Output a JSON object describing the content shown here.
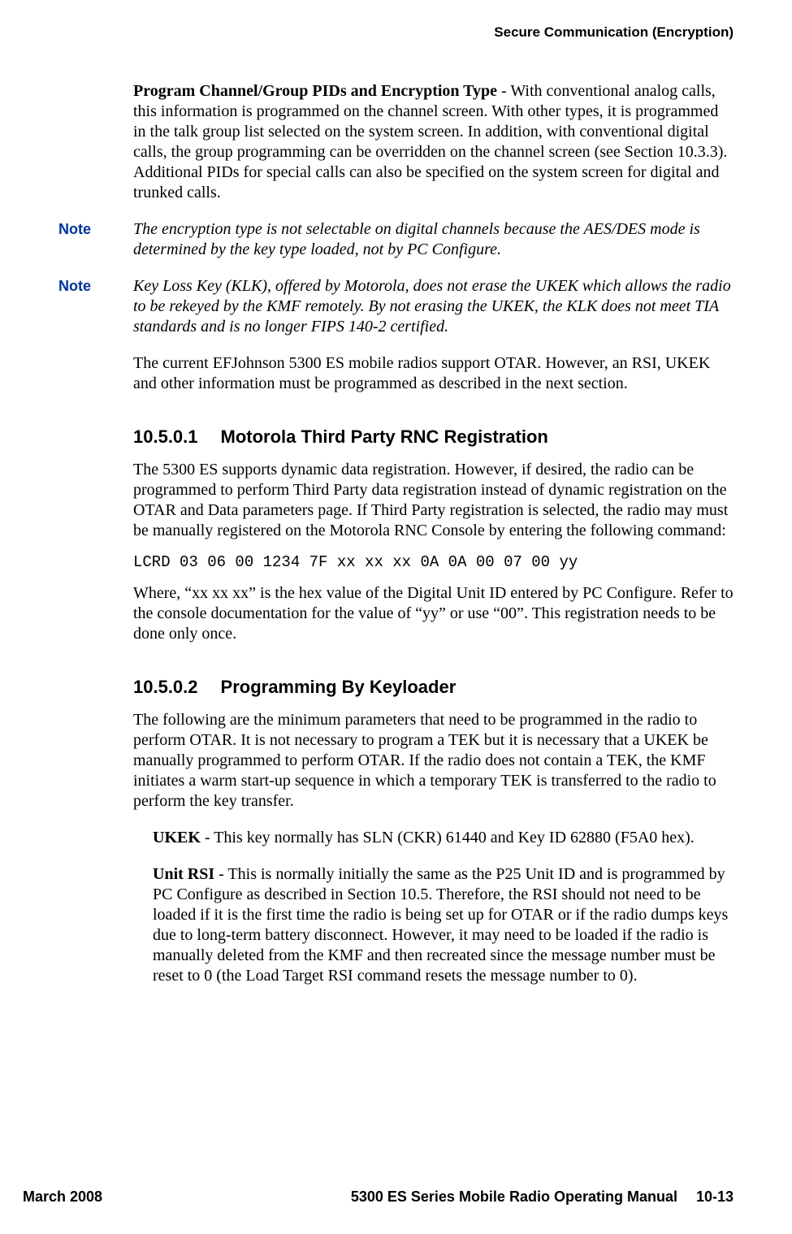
{
  "header": {
    "section_title": "Secure Communication (Encryption)"
  },
  "body": {
    "para1_bold": "Program Channel/Group PIDs and Encryption Type",
    "para1_rest": " - With conventional analog calls, this information is programmed on the channel screen. With other types, it is programmed in the talk group list selected on the system screen. In addition, with conventional digital calls, the group programming can be overridden on the channel screen (see Section 10.3.3). Additional PIDs for special calls can also be specified on the system screen for digital and trunked calls.",
    "note1_label": "Note",
    "note1_text": "The encryption type is not selectable on digital channels because the AES/DES mode is determined by the key type loaded, not by PC Configure.",
    "note2_label": "Note",
    "note2_text": "Key Loss Key (KLK), offered by Motorola, does not erase the UKEK which allows the radio to be rekeyed by the KMF remotely. By not erasing the UKEK, the KLK does not meet TIA standards and is no longer FIPS 140-2 certified.",
    "para2": "The current EFJohnson 5300 ES mobile radios support OTAR. However, an RSI, UKEK and other information must be programmed as described in the next section.",
    "h1_num": "10.5.0.1",
    "h1_title": "Motorola Third Party RNC Registration",
    "para3": "The 5300 ES supports dynamic data registration. However, if desired, the radio can be programmed to perform Third Party data registration instead of dynamic registration on the OTAR and Data parameters page. If Third Party registration is selected, the radio may must be manually registered on the Motorola RNC Console by entering the following command:",
    "code1": "LCRD 03 06 00 1234 7F xx xx xx 0A 0A 00 07 00 yy",
    "para4": "Where, “xx xx xx” is the hex value of the Digital Unit ID entered by PC Configure. Refer to the console documentation for the value of “yy” or use “00”. This registration needs to be done only once.",
    "h2_num": "10.5.0.2",
    "h2_title": "Programming By Keyloader",
    "para5": "The following are the minimum parameters that need to be programmed in the radio to perform OTAR. It is not necessary to program a TEK but it is necessary that a UKEK be manually programmed to perform OTAR. If the radio does not contain a TEK, the KMF initiates a warm start-up sequence in which a temporary TEK is transferred to the radio to perform the key transfer.",
    "ukek_bold": "UKEK",
    "ukek_rest": " - This key normally has SLN (CKR) 61440 and Key ID 62880 (F5A0 hex).",
    "unitrsi_bold": "Unit RSI",
    "unitrsi_rest": " - This is normally initially the same as the P25 Unit ID and is programmed by PC Configure as described in Section 10.5. Therefore, the RSI should not need to be loaded if it is the first time the radio is being set up for OTAR or if the radio dumps keys due to long-term battery disconnect. However, it may need to be loaded if the radio is manually deleted from the KMF and then recreated since the message number must be reset to 0 (the Load Target RSI command resets the message number to 0)."
  },
  "footer": {
    "left": "March 2008",
    "right": "5300 ES Series Mobile Radio Operating Manual  10-13"
  }
}
